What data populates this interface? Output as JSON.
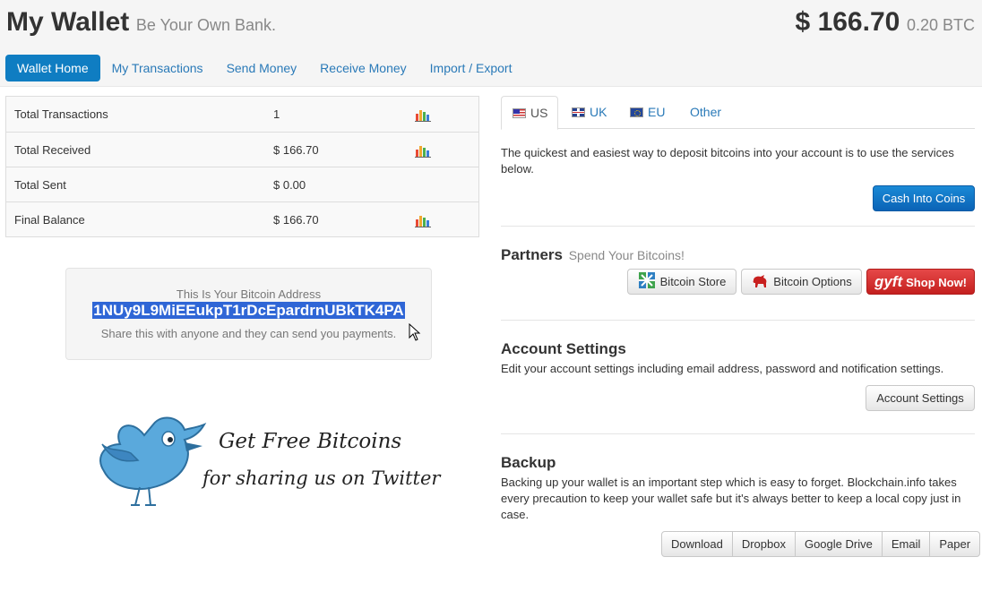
{
  "header": {
    "title": "My Wallet",
    "subtitle": "Be Your Own Bank.",
    "balance_usd": "$ 166.70",
    "balance_btc": "0.20 BTC"
  },
  "nav": {
    "items": [
      {
        "label": "Wallet Home",
        "active": true
      },
      {
        "label": "My Transactions",
        "active": false
      },
      {
        "label": "Send Money",
        "active": false
      },
      {
        "label": "Receive Money",
        "active": false
      },
      {
        "label": "Import / Export",
        "active": false
      }
    ]
  },
  "stats": {
    "rows": [
      {
        "label": "Total Transactions",
        "value": "1",
        "has_chart": true
      },
      {
        "label": "Total Received",
        "value": "$ 166.70",
        "has_chart": true
      },
      {
        "label": "Total Sent",
        "value": "$ 0.00",
        "has_chart": false
      },
      {
        "label": "Final Balance",
        "value": "$ 166.70",
        "has_chart": true
      }
    ]
  },
  "address_box": {
    "caption": "This Is Your Bitcoin Address",
    "address": "1NUy9L9MiEEukpT1rDcEpardrnUBkTK4PA",
    "note": "Share this with anyone and they can send you payments."
  },
  "promo": {
    "line1": "Get Free Bitcoins",
    "line2": "for sharing us on Twitter"
  },
  "region_tabs": {
    "items": [
      {
        "label": "US",
        "flag": "us-flag-icon",
        "active": true
      },
      {
        "label": "UK",
        "flag": "uk-flag-icon",
        "active": false
      },
      {
        "label": "EU",
        "flag": "eu-flag-icon",
        "active": false
      },
      {
        "label": "Other",
        "flag": "",
        "active": false
      }
    ]
  },
  "deposit": {
    "text": "The quickest and easiest way to deposit bitcoins into your account is to use the services below.",
    "button": "Cash Into Coins"
  },
  "partners": {
    "title": "Partners",
    "subtitle": "Spend Your Bitcoins!",
    "buttons": {
      "store": "Bitcoin Store",
      "options": "Bitcoin Options",
      "gyft_logo": "gyft",
      "gyft": "Shop Now!"
    }
  },
  "account": {
    "title": "Account Settings",
    "text": "Edit your account settings including email address, password and notification settings.",
    "button": "Account Settings"
  },
  "backup": {
    "title": "Backup",
    "text": "Backing up your wallet is an important step which is easy to forget. Blockchain.info takes every precaution to keep your wallet safe but it's always better to keep a local copy just in case.",
    "buttons": [
      "Download",
      "Dropbox",
      "Google Drive",
      "Email",
      "Paper"
    ]
  },
  "colors": {
    "primary": "#0f7dc2",
    "link": "#2a7ab8",
    "selection": "#2f66d6",
    "gyft_red": "#d42f2e"
  }
}
